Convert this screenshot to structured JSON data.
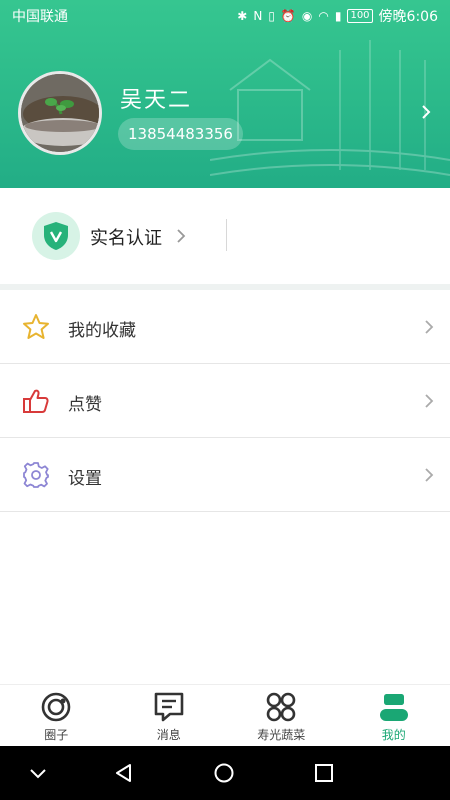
{
  "status_bar": {
    "carrier": "中国联通",
    "battery": "100",
    "time": "傍晚6:06"
  },
  "profile": {
    "name": "吴天二",
    "phone": "13854483356"
  },
  "verification": {
    "label": "实名认证"
  },
  "menu": {
    "items": [
      {
        "label": "我的收藏",
        "icon": "star-icon"
      },
      {
        "label": "点赞",
        "icon": "thumbs-up-icon"
      },
      {
        "label": "设置",
        "icon": "gear-icon"
      }
    ]
  },
  "tabs": [
    {
      "label": "圈子",
      "icon": "circle-icon",
      "active": false
    },
    {
      "label": "消息",
      "icon": "message-icon",
      "active": false
    },
    {
      "label": "寿光蔬菜",
      "icon": "grid-icon",
      "active": false
    },
    {
      "label": "我的",
      "icon": "profile-icon",
      "active": true
    }
  ],
  "colors": {
    "accent": "#1aa774",
    "header": "#2bb98a",
    "star": "#e8b430",
    "thumb": "#d83a3a",
    "gear": "#8d86d4"
  }
}
